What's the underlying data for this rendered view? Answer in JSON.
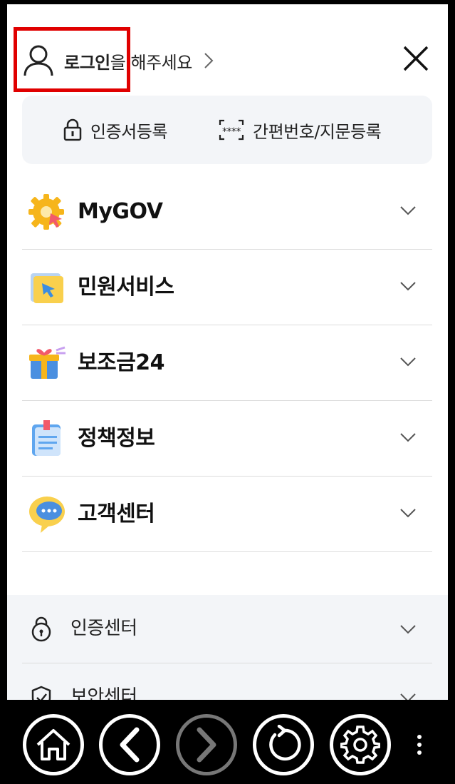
{
  "header": {
    "login_bold": "로그인",
    "login_rest": "을 해주세요",
    "user_icon": "user-icon",
    "close_icon": "close-icon"
  },
  "cert": {
    "register_cert": "인증서등록",
    "register_simple": "간편번호/지문등록"
  },
  "menu": [
    {
      "label": "MyGOV",
      "icon": "gear-icon"
    },
    {
      "label": "민원서비스",
      "icon": "folder-icon"
    },
    {
      "label": "보조금24",
      "icon": "gift-icon"
    },
    {
      "label": "정책정보",
      "icon": "document-icon"
    },
    {
      "label": "고객센터",
      "icon": "chat-bubble-icon"
    }
  ],
  "sub_menu": [
    {
      "label": "인증센터",
      "icon": "lock-icon"
    },
    {
      "label": "보안센터",
      "icon": "shield-icon"
    }
  ],
  "navbar": {
    "buttons": [
      "home-icon",
      "back-icon",
      "forward-icon",
      "refresh-icon",
      "settings-icon",
      "more-icon"
    ]
  },
  "colors": {
    "highlight": "#e00000",
    "cert_bg": "#f3f5f8",
    "navbar_bg": "#000000"
  }
}
